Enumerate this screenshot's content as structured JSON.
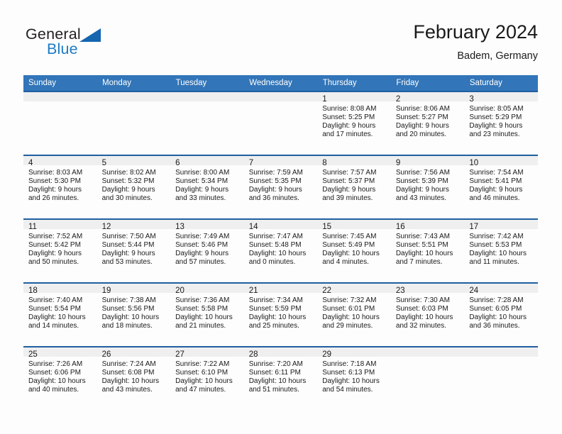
{
  "brand": {
    "name_part1": "General",
    "name_part2": "Blue",
    "logo_icon": "triangle-logo-icon"
  },
  "header": {
    "title": "February 2024",
    "location": "Badem, Germany"
  },
  "calendar": {
    "weekday_headers": [
      "Sunday",
      "Monday",
      "Tuesday",
      "Wednesday",
      "Thursday",
      "Friday",
      "Saturday"
    ],
    "colors": {
      "header_blue": "#3275b8",
      "row_rule": "#1f5fa0",
      "daynum_band": "#efefef",
      "brand_blue": "#1e7bc4",
      "page_background": "#fdfdfd"
    },
    "weeks": [
      [
        {
          "day": "",
          "sunrise": "",
          "sunset": "",
          "daylight_line1": "",
          "daylight_line2": ""
        },
        {
          "day": "",
          "sunrise": "",
          "sunset": "",
          "daylight_line1": "",
          "daylight_line2": ""
        },
        {
          "day": "",
          "sunrise": "",
          "sunset": "",
          "daylight_line1": "",
          "daylight_line2": ""
        },
        {
          "day": "",
          "sunrise": "",
          "sunset": "",
          "daylight_line1": "",
          "daylight_line2": ""
        },
        {
          "day": "1",
          "sunrise": "Sunrise: 8:08 AM",
          "sunset": "Sunset: 5:25 PM",
          "daylight_line1": "Daylight: 9 hours",
          "daylight_line2": "and 17 minutes."
        },
        {
          "day": "2",
          "sunrise": "Sunrise: 8:06 AM",
          "sunset": "Sunset: 5:27 PM",
          "daylight_line1": "Daylight: 9 hours",
          "daylight_line2": "and 20 minutes."
        },
        {
          "day": "3",
          "sunrise": "Sunrise: 8:05 AM",
          "sunset": "Sunset: 5:29 PM",
          "daylight_line1": "Daylight: 9 hours",
          "daylight_line2": "and 23 minutes."
        }
      ],
      [
        {
          "day": "4",
          "sunrise": "Sunrise: 8:03 AM",
          "sunset": "Sunset: 5:30 PM",
          "daylight_line1": "Daylight: 9 hours",
          "daylight_line2": "and 26 minutes."
        },
        {
          "day": "5",
          "sunrise": "Sunrise: 8:02 AM",
          "sunset": "Sunset: 5:32 PM",
          "daylight_line1": "Daylight: 9 hours",
          "daylight_line2": "and 30 minutes."
        },
        {
          "day": "6",
          "sunrise": "Sunrise: 8:00 AM",
          "sunset": "Sunset: 5:34 PM",
          "daylight_line1": "Daylight: 9 hours",
          "daylight_line2": "and 33 minutes."
        },
        {
          "day": "7",
          "sunrise": "Sunrise: 7:59 AM",
          "sunset": "Sunset: 5:35 PM",
          "daylight_line1": "Daylight: 9 hours",
          "daylight_line2": "and 36 minutes."
        },
        {
          "day": "8",
          "sunrise": "Sunrise: 7:57 AM",
          "sunset": "Sunset: 5:37 PM",
          "daylight_line1": "Daylight: 9 hours",
          "daylight_line2": "and 39 minutes."
        },
        {
          "day": "9",
          "sunrise": "Sunrise: 7:56 AM",
          "sunset": "Sunset: 5:39 PM",
          "daylight_line1": "Daylight: 9 hours",
          "daylight_line2": "and 43 minutes."
        },
        {
          "day": "10",
          "sunrise": "Sunrise: 7:54 AM",
          "sunset": "Sunset: 5:41 PM",
          "daylight_line1": "Daylight: 9 hours",
          "daylight_line2": "and 46 minutes."
        }
      ],
      [
        {
          "day": "11",
          "sunrise": "Sunrise: 7:52 AM",
          "sunset": "Sunset: 5:42 PM",
          "daylight_line1": "Daylight: 9 hours",
          "daylight_line2": "and 50 minutes."
        },
        {
          "day": "12",
          "sunrise": "Sunrise: 7:50 AM",
          "sunset": "Sunset: 5:44 PM",
          "daylight_line1": "Daylight: 9 hours",
          "daylight_line2": "and 53 minutes."
        },
        {
          "day": "13",
          "sunrise": "Sunrise: 7:49 AM",
          "sunset": "Sunset: 5:46 PM",
          "daylight_line1": "Daylight: 9 hours",
          "daylight_line2": "and 57 minutes."
        },
        {
          "day": "14",
          "sunrise": "Sunrise: 7:47 AM",
          "sunset": "Sunset: 5:48 PM",
          "daylight_line1": "Daylight: 10 hours",
          "daylight_line2": "and 0 minutes."
        },
        {
          "day": "15",
          "sunrise": "Sunrise: 7:45 AM",
          "sunset": "Sunset: 5:49 PM",
          "daylight_line1": "Daylight: 10 hours",
          "daylight_line2": "and 4 minutes."
        },
        {
          "day": "16",
          "sunrise": "Sunrise: 7:43 AM",
          "sunset": "Sunset: 5:51 PM",
          "daylight_line1": "Daylight: 10 hours",
          "daylight_line2": "and 7 minutes."
        },
        {
          "day": "17",
          "sunrise": "Sunrise: 7:42 AM",
          "sunset": "Sunset: 5:53 PM",
          "daylight_line1": "Daylight: 10 hours",
          "daylight_line2": "and 11 minutes."
        }
      ],
      [
        {
          "day": "18",
          "sunrise": "Sunrise: 7:40 AM",
          "sunset": "Sunset: 5:54 PM",
          "daylight_line1": "Daylight: 10 hours",
          "daylight_line2": "and 14 minutes."
        },
        {
          "day": "19",
          "sunrise": "Sunrise: 7:38 AM",
          "sunset": "Sunset: 5:56 PM",
          "daylight_line1": "Daylight: 10 hours",
          "daylight_line2": "and 18 minutes."
        },
        {
          "day": "20",
          "sunrise": "Sunrise: 7:36 AM",
          "sunset": "Sunset: 5:58 PM",
          "daylight_line1": "Daylight: 10 hours",
          "daylight_line2": "and 21 minutes."
        },
        {
          "day": "21",
          "sunrise": "Sunrise: 7:34 AM",
          "sunset": "Sunset: 5:59 PM",
          "daylight_line1": "Daylight: 10 hours",
          "daylight_line2": "and 25 minutes."
        },
        {
          "day": "22",
          "sunrise": "Sunrise: 7:32 AM",
          "sunset": "Sunset: 6:01 PM",
          "daylight_line1": "Daylight: 10 hours",
          "daylight_line2": "and 29 minutes."
        },
        {
          "day": "23",
          "sunrise": "Sunrise: 7:30 AM",
          "sunset": "Sunset: 6:03 PM",
          "daylight_line1": "Daylight: 10 hours",
          "daylight_line2": "and 32 minutes."
        },
        {
          "day": "24",
          "sunrise": "Sunrise: 7:28 AM",
          "sunset": "Sunset: 6:05 PM",
          "daylight_line1": "Daylight: 10 hours",
          "daylight_line2": "and 36 minutes."
        }
      ],
      [
        {
          "day": "25",
          "sunrise": "Sunrise: 7:26 AM",
          "sunset": "Sunset: 6:06 PM",
          "daylight_line1": "Daylight: 10 hours",
          "daylight_line2": "and 40 minutes."
        },
        {
          "day": "26",
          "sunrise": "Sunrise: 7:24 AM",
          "sunset": "Sunset: 6:08 PM",
          "daylight_line1": "Daylight: 10 hours",
          "daylight_line2": "and 43 minutes."
        },
        {
          "day": "27",
          "sunrise": "Sunrise: 7:22 AM",
          "sunset": "Sunset: 6:10 PM",
          "daylight_line1": "Daylight: 10 hours",
          "daylight_line2": "and 47 minutes."
        },
        {
          "day": "28",
          "sunrise": "Sunrise: 7:20 AM",
          "sunset": "Sunset: 6:11 PM",
          "daylight_line1": "Daylight: 10 hours",
          "daylight_line2": "and 51 minutes."
        },
        {
          "day": "29",
          "sunrise": "Sunrise: 7:18 AM",
          "sunset": "Sunset: 6:13 PM",
          "daylight_line1": "Daylight: 10 hours",
          "daylight_line2": "and 54 minutes."
        },
        {
          "day": "",
          "sunrise": "",
          "sunset": "",
          "daylight_line1": "",
          "daylight_line2": ""
        },
        {
          "day": "",
          "sunrise": "",
          "sunset": "",
          "daylight_line1": "",
          "daylight_line2": ""
        }
      ]
    ]
  }
}
